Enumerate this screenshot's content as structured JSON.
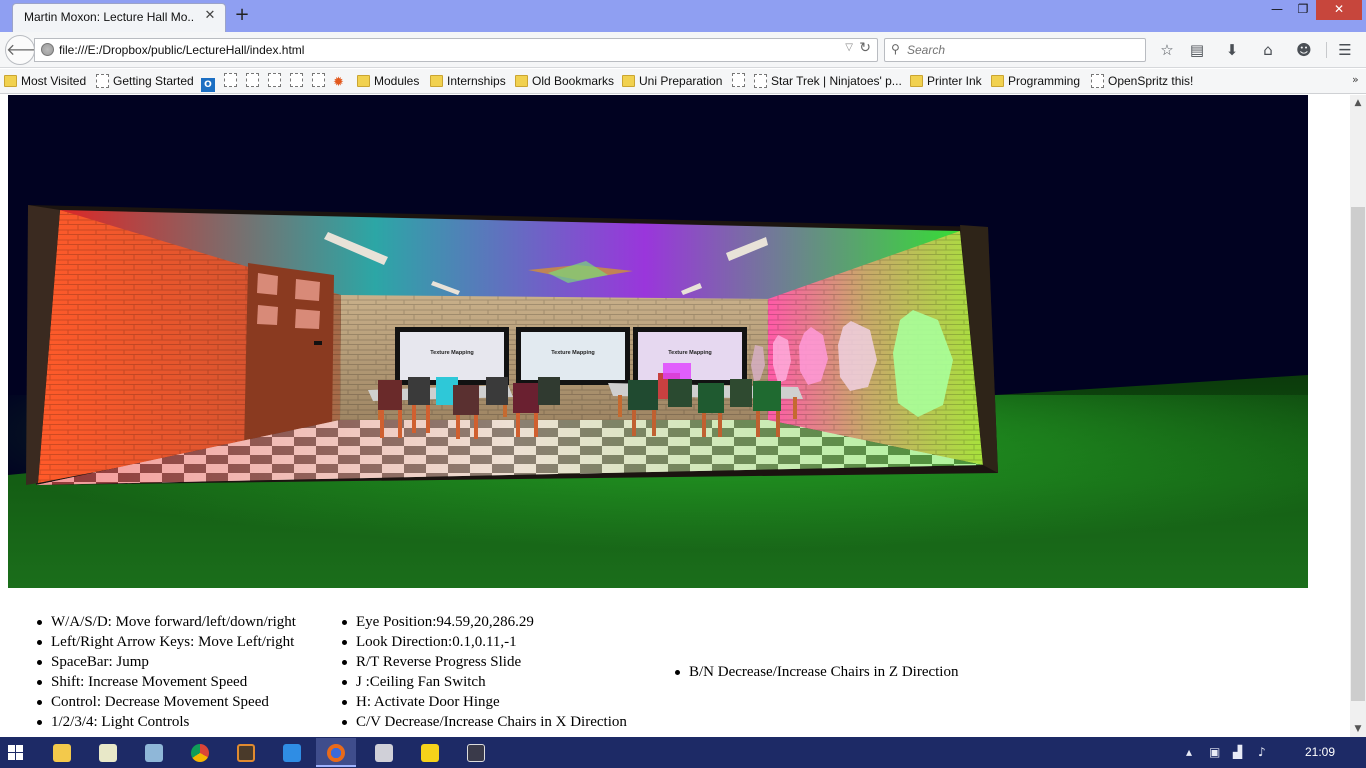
{
  "browser": {
    "tab": {
      "title": "Martin Moxon: Lecture Hall Mo..."
    },
    "new_tab_icon": "plus-icon",
    "window_controls": [
      "minimize",
      "maximize",
      "close"
    ],
    "url": "file:///E:/Dropbox/public/LectureHall/index.html",
    "search_placeholder": "Search",
    "toolbar_icons": [
      "star-icon",
      "reading-list-icon",
      "download-icon",
      "home-icon",
      "chat-icon",
      "menu-icon"
    ],
    "bookmarks": [
      {
        "type": "page",
        "label": "Most Visited"
      },
      {
        "type": "blank",
        "label": "Getting Started"
      },
      {
        "type": "outlook",
        "label": ""
      },
      {
        "type": "blank",
        "label": ""
      },
      {
        "type": "blank",
        "label": ""
      },
      {
        "type": "blank",
        "label": ""
      },
      {
        "type": "blank",
        "label": ""
      },
      {
        "type": "blank",
        "label": ""
      },
      {
        "type": "fire",
        "label": ""
      },
      {
        "type": "folder",
        "label": "Modules"
      },
      {
        "type": "folder",
        "label": "Internships"
      },
      {
        "type": "folder",
        "label": "Old Bookmarks"
      },
      {
        "type": "folder",
        "label": "Uni Preparation"
      },
      {
        "type": "blank",
        "label": ""
      },
      {
        "type": "blank",
        "label": "Star Trek | Ninjatoes' p..."
      },
      {
        "type": "folder",
        "label": "Printer Ink"
      },
      {
        "type": "folder",
        "label": "Programming"
      },
      {
        "type": "blank",
        "label": "OpenSpritz this!"
      }
    ]
  },
  "scene": {
    "screens": [
      {
        "heading": "Texture Mapping"
      },
      {
        "heading": "Texture Mapping"
      },
      {
        "heading": "Texture Mapping"
      }
    ],
    "colors": {
      "sky": "#010221",
      "grass": "#176317",
      "left_wall": "#e0502a",
      "right_wall": "#b8e23c",
      "ceiling_glow": [
        "#ff2a2a",
        "#2fe0e0",
        "#b03cff",
        "#3cff3c"
      ],
      "hexagon_light": "#a8ff9a",
      "hexagon_pink": "#ff9ad8"
    }
  },
  "controls": {
    "column1": [
      "W/A/S/D: Move forward/left/down/right",
      "Left/Right Arrow Keys: Move Left/right",
      "SpaceBar: Jump",
      "Shift: Increase Movement Speed",
      "Control: Decrease Movement Speed",
      "1/2/3/4: Light Controls"
    ],
    "column2": [
      "Eye Position:94.59,20,286.29",
      "Look Direction:0.1,0.11,-1",
      "R/T Reverse Progress Slide",
      "J :Ceiling Fan Switch",
      "H: Activate Door Hinge",
      "C/V Decrease/Increase Chairs in X Direction"
    ],
    "column3": [
      "B/N Decrease/Increase Chairs in Z Direction"
    ]
  },
  "taskbar": {
    "apps": [
      "file-explorer",
      "notepad",
      "photo-viewer",
      "chrome",
      "sublime",
      "wps-writer",
      "firefox",
      "paint",
      "chat-app",
      "task-app"
    ],
    "tray_icons": [
      "show-hidden-icons",
      "network-icon",
      "signal-icon",
      "volume-icon"
    ],
    "clock": "21:09"
  }
}
